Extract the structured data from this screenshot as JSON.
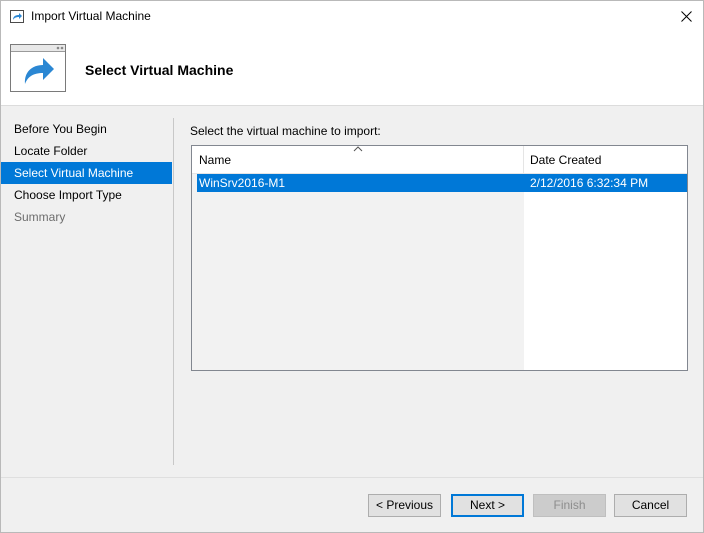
{
  "window": {
    "title": "Import Virtual Machine",
    "heading": "Select Virtual Machine"
  },
  "nav": {
    "items": [
      {
        "label": "Before You Begin",
        "state": "normal"
      },
      {
        "label": "Locate Folder",
        "state": "normal"
      },
      {
        "label": "Select Virtual Machine",
        "state": "selected"
      },
      {
        "label": "Choose Import Type",
        "state": "normal"
      },
      {
        "label": "Summary",
        "state": "disabled"
      }
    ]
  },
  "main": {
    "prompt": "Select the virtual machine to import:",
    "table": {
      "columns": [
        "Name",
        "Date Created"
      ],
      "sorted_column": "Name",
      "rows": [
        {
          "name": "WinSrv2016-M1",
          "date_created": "2/12/2016 6:32:34 PM",
          "selected": true
        }
      ]
    }
  },
  "buttons": {
    "previous": "< Previous",
    "next": "Next >",
    "finish": "Finish",
    "cancel": "Cancel"
  },
  "colors": {
    "accent": "#0078d7",
    "background": "#f0f0f0",
    "header_bg": "#ffffff"
  },
  "icons": {
    "app": "import-arrow-icon",
    "banner": "import-window-icon",
    "close": "close-icon",
    "sort": "sort-ascending-icon"
  }
}
